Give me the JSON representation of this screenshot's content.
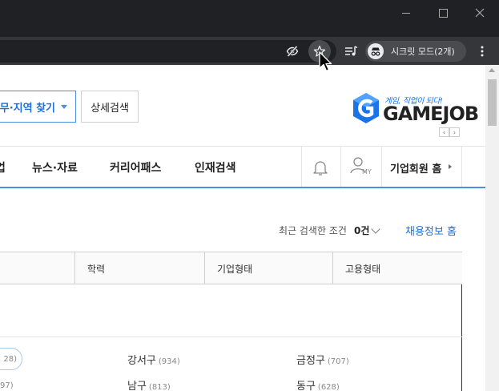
{
  "browser": {
    "window_controls": {
      "minimize": "minimize",
      "maximize": "maximize",
      "close": "close"
    },
    "toolbar": {
      "icons": [
        "eye-off-icon",
        "star-icon",
        "media-control-icon",
        "incognito-icon",
        "more-icon"
      ],
      "incognito_label": "시크릿 모드(2개)"
    }
  },
  "header": {
    "search_region_label": "무·지역 찾기",
    "detail_search_label": "상세검색",
    "logo": {
      "tagline": "게임, 직업이 되다!",
      "wordmark": "GAMEJOB",
      "prev": "‹",
      "next": "›"
    }
  },
  "gnb": {
    "cut_left": "업",
    "items": [
      "뉴스·자료",
      "커리어패스",
      "인재검색"
    ],
    "my_label": "MY",
    "biz_home": "기업회원 홈"
  },
  "filter_bar": {
    "recent_label": "최근 검색한 조건",
    "recent_count": "0건",
    "jobinfo_home": "채용정보 홈"
  },
  "tabs": [
    "학력",
    "기업형태",
    "고용형태"
  ],
  "districts": {
    "pill_count": "28)",
    "cut_count": "97)",
    "items": [
      {
        "name": "강서구",
        "count": "(934)"
      },
      {
        "name": "금정구",
        "count": "(707)"
      },
      {
        "name": "남구",
        "count": "(813)"
      },
      {
        "name": "동구",
        "count": "(628)"
      }
    ]
  },
  "colors": {
    "accent": "#4a90e2",
    "link": "#1e6fd9",
    "chrome_dark": "#202124",
    "chrome_toolbar": "#35363a"
  }
}
